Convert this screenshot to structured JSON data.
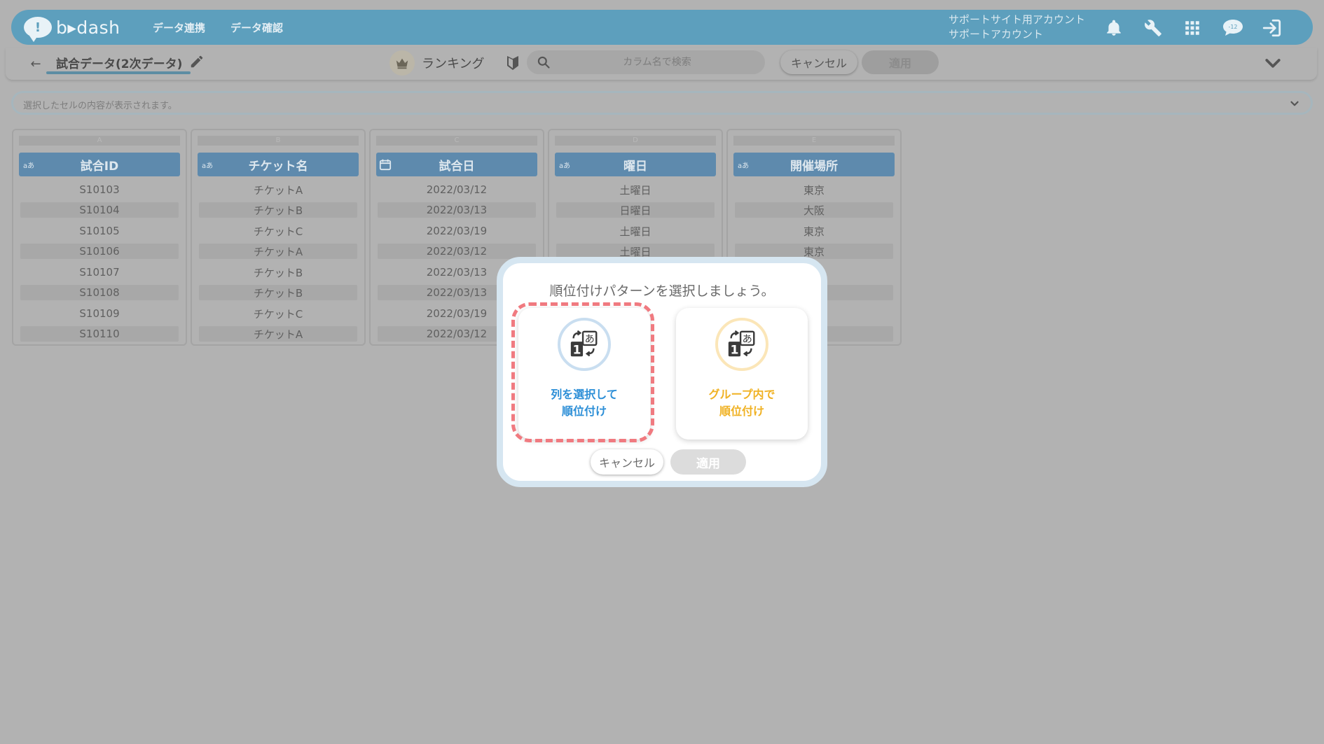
{
  "header": {
    "logo_text": "b▸dash",
    "nav": [
      {
        "label": "データ連携"
      },
      {
        "label": "データ確認"
      }
    ],
    "account_line1": "サポートサイト用アカウント",
    "account_line2": "サポートアカウント",
    "icons": [
      "bell-icon",
      "wrench-icon",
      "apps-grid-icon",
      "chat-icon",
      "logout-icon"
    ],
    "chat_badge": "-12"
  },
  "toolbar": {
    "back_glyph": "←",
    "data_title": "試合データ(2次データ)",
    "rank_label": "ランキング",
    "search_placeholder": "カラム名で検索",
    "cancel_label": "キャンセル",
    "apply_label": "適用"
  },
  "cellbar": {
    "placeholder": "選択したセルの内容が表示されます。"
  },
  "table": {
    "columns": [
      {
        "letter": "A",
        "type": "aあ",
        "name": "試合ID",
        "values": [
          "S10103",
          "S10104",
          "S10105",
          "S10106",
          "S10107",
          "S10108",
          "S10109",
          "S10110"
        ]
      },
      {
        "letter": "B",
        "type": "aあ",
        "name": "チケット名",
        "values": [
          "チケットA",
          "チケットB",
          "チケットC",
          "チケットA",
          "チケットB",
          "チケットB",
          "チケットC",
          "チケットA"
        ]
      },
      {
        "letter": "C",
        "type": "calendar",
        "name": "試合日",
        "values": [
          "2022/03/12",
          "2022/03/13",
          "2022/03/19",
          "2022/03/12",
          "2022/03/13",
          "2022/03/13",
          "2022/03/19",
          "2022/03/12"
        ]
      },
      {
        "letter": "D",
        "type": "aあ",
        "name": "曜日",
        "values": [
          "土曜日",
          "日曜日",
          "土曜日",
          "土曜日",
          "",
          "",
          "",
          ""
        ]
      },
      {
        "letter": "E",
        "type": "aあ",
        "name": "開催場所",
        "values": [
          "東京",
          "大阪",
          "東京",
          "東京",
          "",
          "",
          "",
          ""
        ]
      }
    ]
  },
  "modal": {
    "title": "順位付けパターンを選択しましょう。",
    "options": [
      {
        "line1": "列を選択して",
        "line2": "順位付け",
        "color": "#2d8fd7"
      },
      {
        "line1": "グループ内で",
        "line2": "順位付け",
        "color": "#f0b224"
      }
    ],
    "cancel_label": "キャンセル",
    "apply_label": "適用"
  }
}
